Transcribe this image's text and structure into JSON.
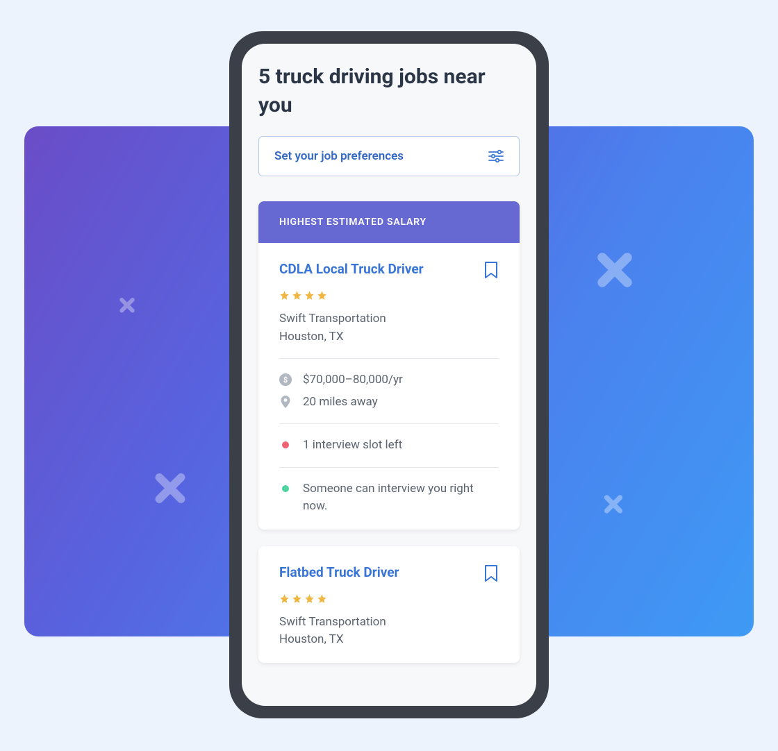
{
  "header": {
    "title": "5 truck driving jobs near you"
  },
  "preferences": {
    "label": "Set your job preferences"
  },
  "jobs": [
    {
      "badge": "HIGHEST ESTIMATED SALARY",
      "title": "CDLA Local Truck Driver",
      "rating": 4,
      "company": "Swift Transportation",
      "location": "Houston, TX",
      "salary": "$70,000–80,000/yr",
      "distance": "20 miles away",
      "interview_slots": "1 interview slot left",
      "availability": "Someone can interview you right now."
    },
    {
      "title": "Flatbed Truck Driver",
      "rating": 4,
      "company": "Swift Transportation",
      "location": "Houston, TX"
    }
  ]
}
